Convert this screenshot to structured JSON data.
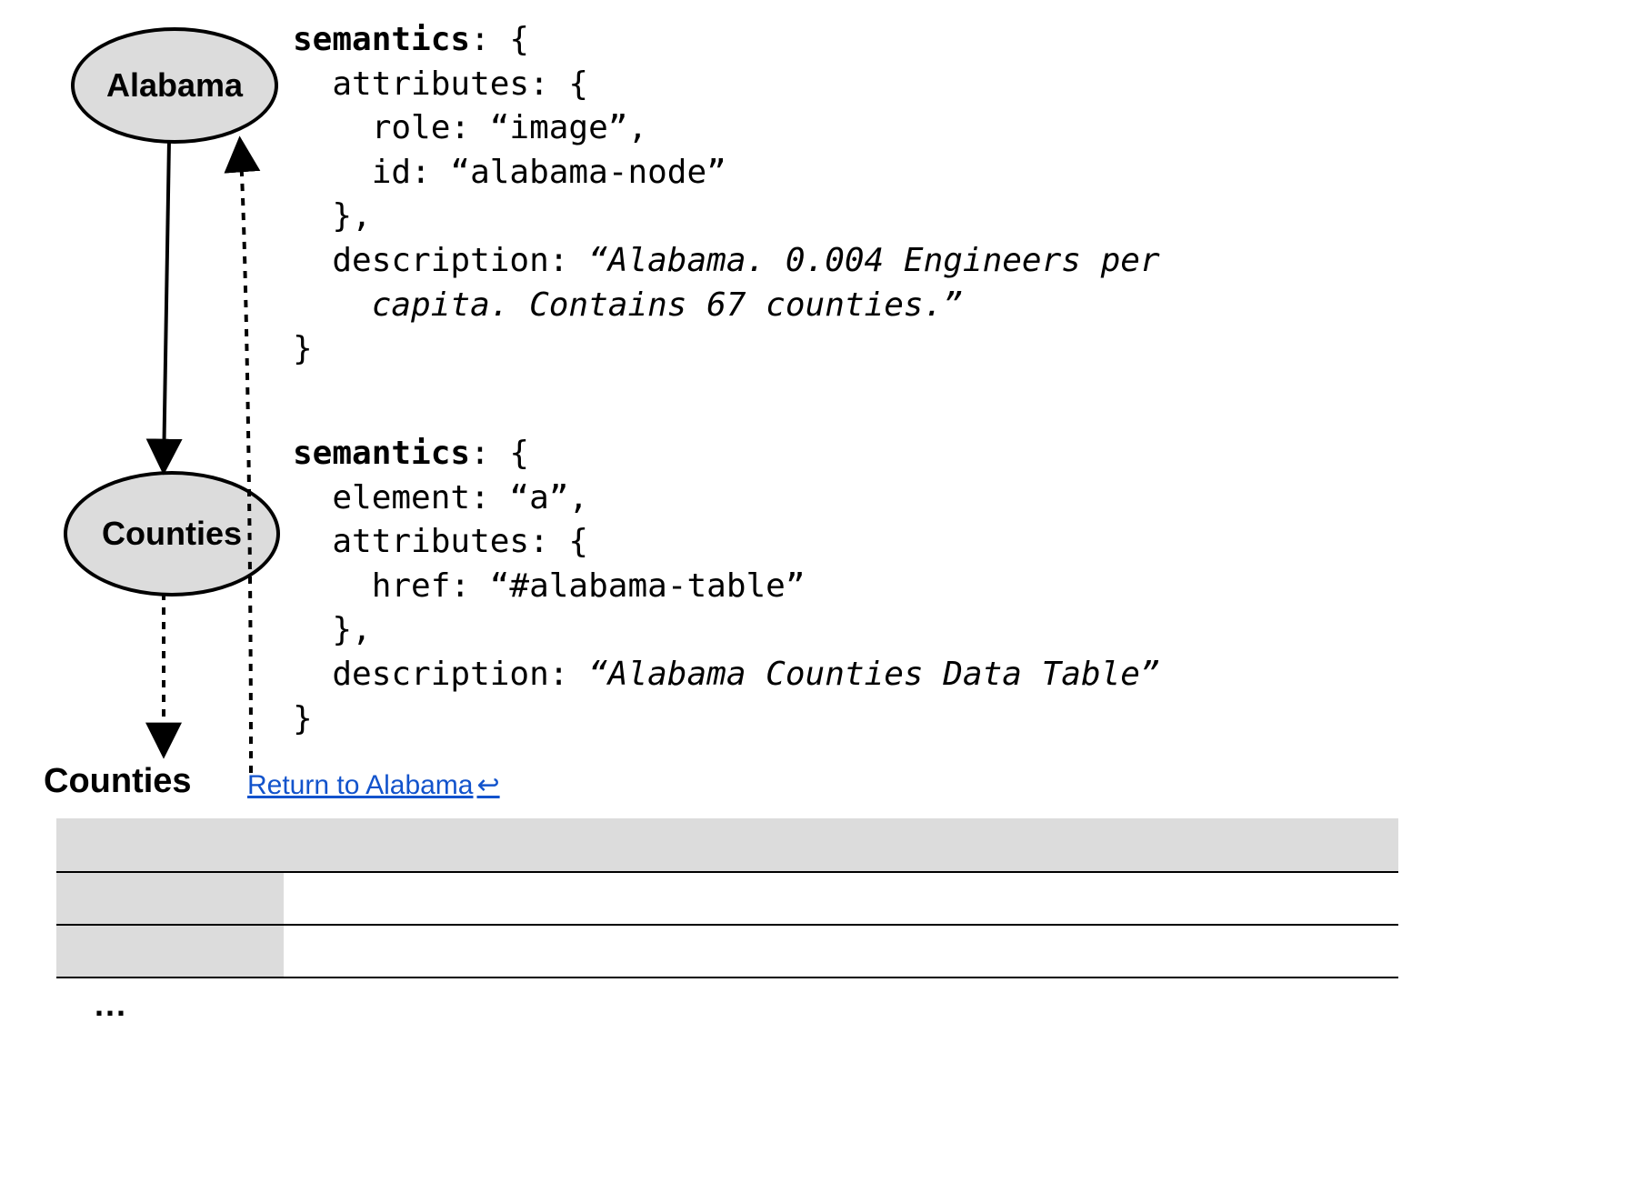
{
  "nodes": {
    "alabama": {
      "label": "Alabama"
    },
    "counties": {
      "label": "Counties"
    }
  },
  "code1": {
    "keyword": "semantics",
    "l1": ": {",
    "l2": "  attributes: {",
    "l3": "    role: “image”,",
    "l4": "    id: “alabama-node”",
    "l5": "  },",
    "l6a": "  description: ",
    "l6b": "“Alabama. 0.004 Engineers per",
    "l7": "    capita. Contains 67 counties.”",
    "l8": "}"
  },
  "code2": {
    "keyword": "semantics",
    "l1": ": {",
    "l2": "  element: “a”,",
    "l3": "  attributes: {",
    "l4": "    href: “#alabama-table”",
    "l5": "  },",
    "l6a": "  description: ",
    "l6b": "“Alabama Counties Data Table”",
    "l7": "}"
  },
  "table": {
    "title": "Counties",
    "return_link": "Return to Alabama",
    "return_icon": "↩",
    "ellipsis": "..."
  }
}
